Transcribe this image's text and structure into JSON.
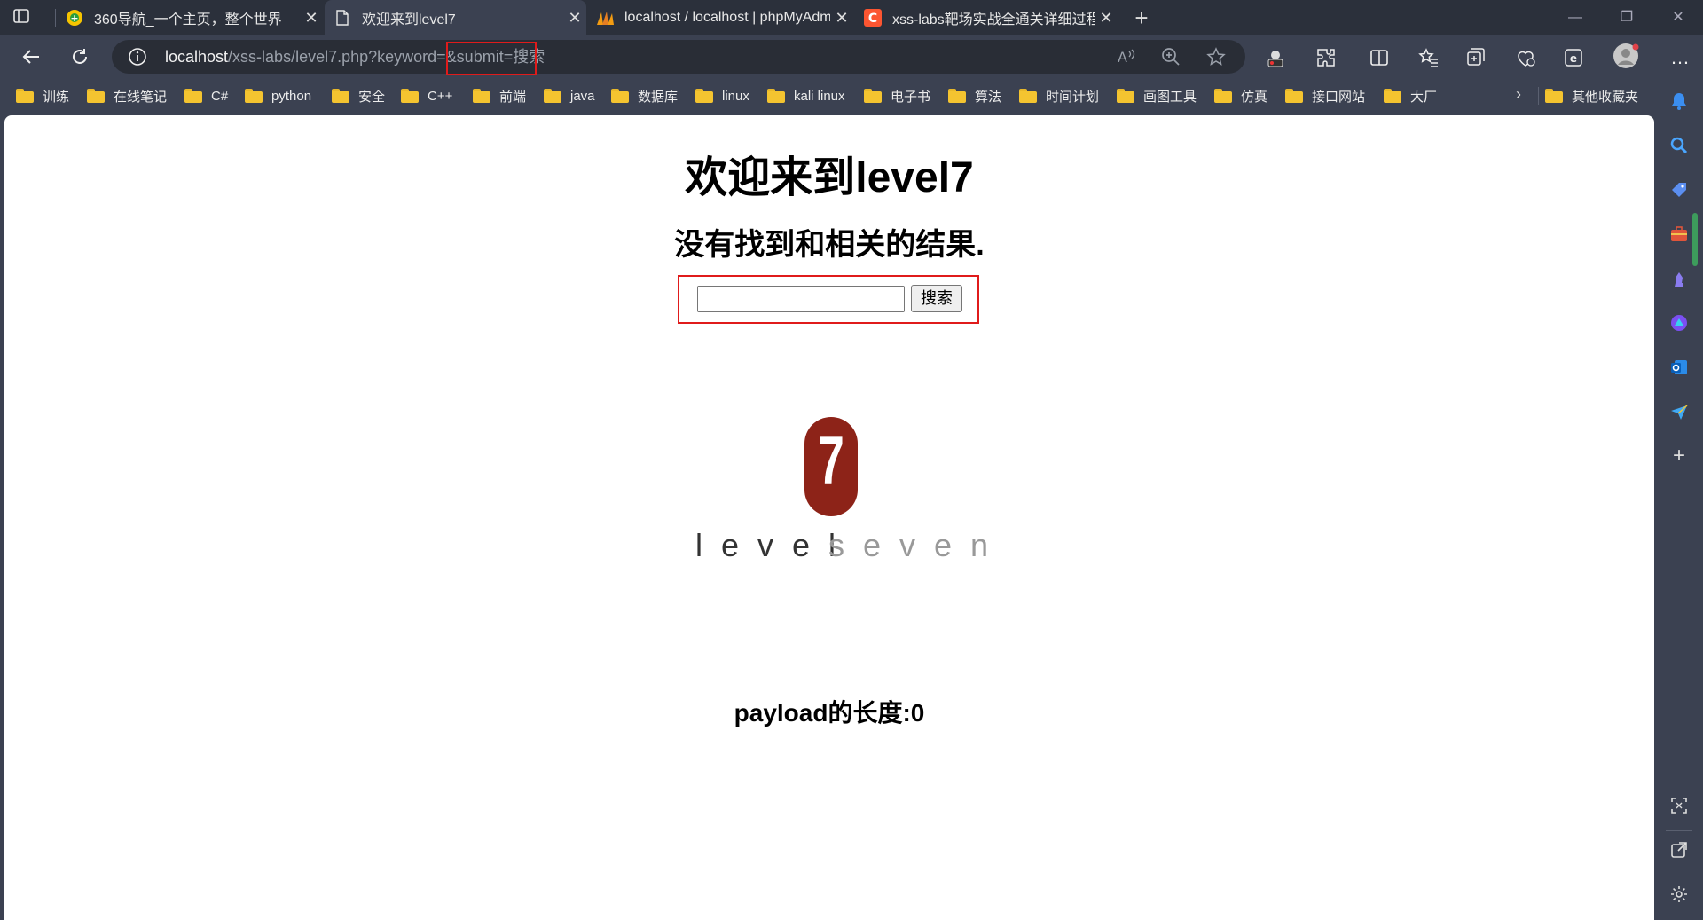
{
  "tabs": [
    {
      "title": "360导航_一个主页，整个世界",
      "active": false
    },
    {
      "title": "欢迎来到level7",
      "active": true
    },
    {
      "title": "localhost / localhost | phpMyAdmin",
      "active": false
    },
    {
      "title": "xss-labs靶场实战全通关详细过程",
      "active": false
    }
  ],
  "address": {
    "host": "localhost",
    "path": "/xss-labs/level7.php?keyword=&submit=搜索"
  },
  "bookmarks": [
    "训练",
    "在线笔记",
    "C#",
    "python",
    "安全",
    "C++",
    "前端",
    "java",
    "数据库",
    "linux",
    "kali linux",
    "电子书",
    "算法",
    "时间计划",
    "画图工具",
    "仿真",
    "接口网站",
    "大厂"
  ],
  "other_bookmarks": "其他收藏夹",
  "page": {
    "heading": "欢迎来到level7",
    "result": "没有找到和相关的结果.",
    "search_value": "",
    "search_button": "搜索",
    "logo_number": "7",
    "logo_text_dark": "level",
    "logo_text_light": "seven",
    "payload_length": "payload的长度:0"
  },
  "colors": {
    "highlight_border": "#e01b1b",
    "logo_red": "#8d2318"
  }
}
